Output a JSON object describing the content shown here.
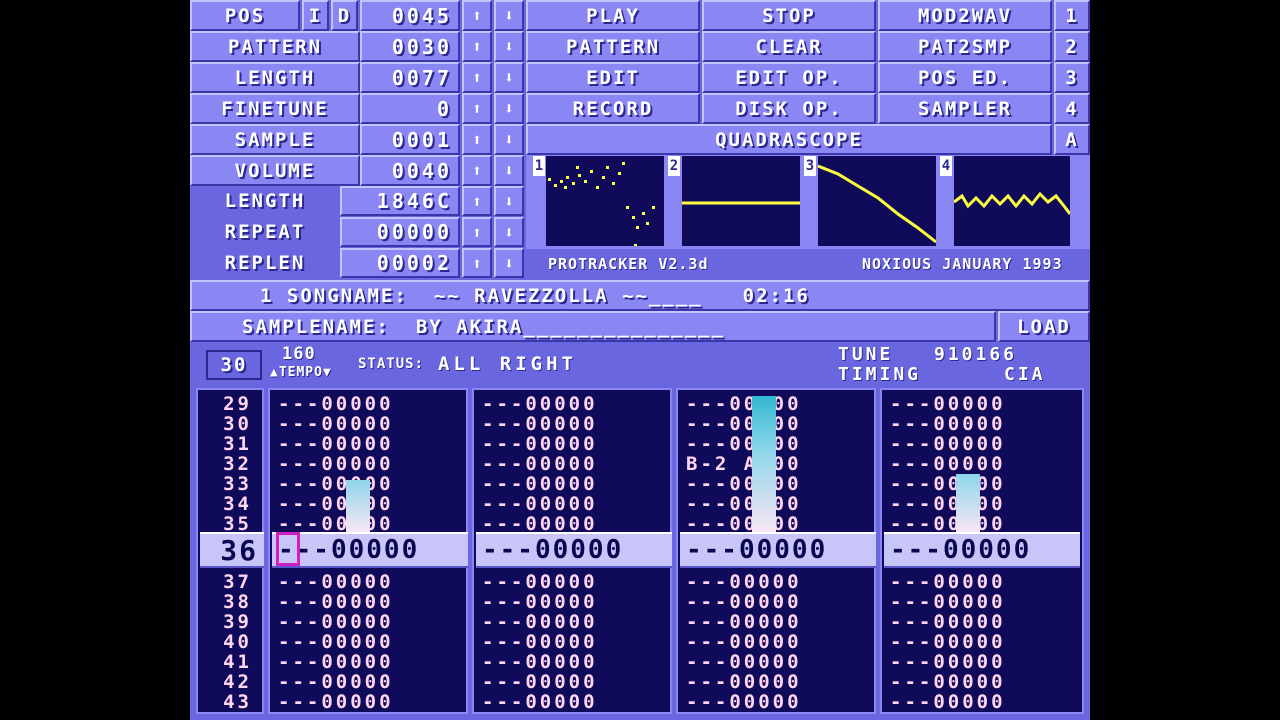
{
  "top": {
    "pos": {
      "label": "POS",
      "i": "I",
      "d": "D",
      "value": "0045"
    },
    "pattern": {
      "label": "PATTERN",
      "value": "0030"
    },
    "length": {
      "label": "LENGTH",
      "value": "0077"
    },
    "finetune": {
      "label": "FINETUNE",
      "value": "0"
    },
    "sample": {
      "label": "SAMPLE",
      "value": "0001"
    },
    "volume": {
      "label": "VOLUME",
      "value": "0040"
    },
    "slength": {
      "label": "LENGTH",
      "value": "1846C"
    },
    "repeat": {
      "label": "REPEAT",
      "value": "00000"
    },
    "replen": {
      "label": "REPLEN",
      "value": "00002"
    },
    "up": "⬆",
    "down": "⬇"
  },
  "buttons": {
    "play": "PLAY",
    "stop": "STOP",
    "mod2wav": "MOD2WAV",
    "k1": "1",
    "pattern": "PATTERN",
    "clear": "CLEAR",
    "pat2smp": "PAT2SMP",
    "k2": "2",
    "edit": "EDIT",
    "editop": "EDIT OP.",
    "posed": "POS ED.",
    "k3": "3",
    "record": "RECORD",
    "diskop": "DISK OP.",
    "sampler": "SAMPLER",
    "k4": "4",
    "quadrascope": "QUADRASCOPE",
    "ka": "A"
  },
  "scopes": {
    "n1": "1",
    "n2": "2",
    "n3": "3",
    "n4": "4"
  },
  "version": "PROTRACKER V2.3d",
  "credit": "NOXIOUS JANUARY 1993",
  "song": {
    "label": "1 SONGNAME:",
    "value": "~~ RAVEZZOLLA ~~____",
    "time": "02:16"
  },
  "samplename": {
    "label": "SAMPLENAME:",
    "value": "BY AKIRA_______________",
    "load": "LOAD"
  },
  "status": {
    "pattern": "30",
    "tempo": "160",
    "tempo_label": "▲TEMPO▼",
    "status_label": "STATUS:",
    "status_value": "ALL RIGHT",
    "tune_label": "TUNE",
    "tune_value": "910166",
    "timing_label": "TIMING",
    "timing_value": "CIA"
  },
  "rows": {
    "numbers": [
      "29",
      "30",
      "31",
      "32",
      "33",
      "34",
      "35"
    ],
    "current": "36",
    "after": [
      "37",
      "38",
      "39",
      "40",
      "41",
      "42",
      "43"
    ],
    "empty": "---00000",
    "ch3_row32": "B-2 A000",
    "cur_ch1": "---00000"
  },
  "colors": {
    "bg": "#6a66e0",
    "button": "#8a86f4",
    "pattern_bg": "#100a5a",
    "note": "#ffd6f2",
    "scope_wave": "#ffff40"
  }
}
